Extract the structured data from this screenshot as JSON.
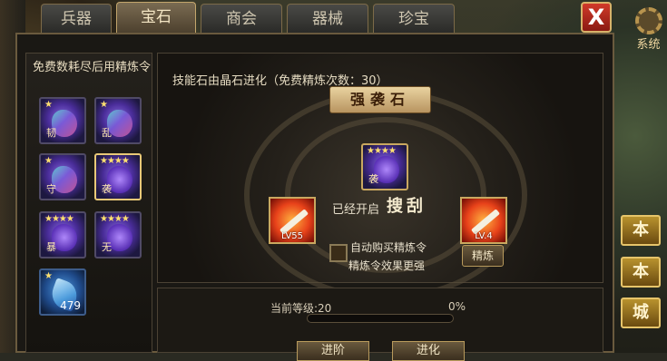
{
  "tabs": [
    {
      "label": "兵器",
      "active": false
    },
    {
      "label": "宝石",
      "active": true
    },
    {
      "label": "商会",
      "active": false
    },
    {
      "label": "器械",
      "active": false
    },
    {
      "label": "珍宝",
      "active": false
    }
  ],
  "close_label": "X",
  "system_label": "系统",
  "left_panel": {
    "title": "免费数耗尽后用精炼令",
    "gems": [
      {
        "stars": "★",
        "char": "韧",
        "type": "rainbow"
      },
      {
        "stars": "★",
        "char": "乱",
        "type": "rainbow"
      },
      {
        "stars": "★",
        "char": "守",
        "type": "rainbow"
      },
      {
        "stars": "★★★★",
        "char": "袭",
        "type": "purple",
        "selected": true
      },
      {
        "stars": "★★★★",
        "char": "暴",
        "type": "purple"
      },
      {
        "stars": "★★★★",
        "char": "无",
        "type": "purple"
      },
      {
        "stars": "★",
        "char": "",
        "type": "crystal",
        "count": "479"
      }
    ]
  },
  "main": {
    "info": "技能石由晶石进化（免费精炼次数：30）",
    "stone_title": "强袭石",
    "center_stars": "★★★★",
    "center_char": "袭",
    "left_slot_level": "LV55",
    "right_slot_level": "LV.4",
    "opened_label": "已经开启",
    "opened_skill": "搜刮",
    "auto_buy": "自动购买精炼令",
    "auto_effect": "精炼令效果更强",
    "refine_label": "精炼"
  },
  "bottom": {
    "level_text": "当前等级:20",
    "percent_text": "0%",
    "progress": 0,
    "advance_label": "进阶",
    "evolve_label": "进化"
  },
  "side_buttons": [
    "本",
    "本",
    "城"
  ],
  "colors": {
    "accent": "#d6b65e",
    "close": "#d13a2a"
  }
}
